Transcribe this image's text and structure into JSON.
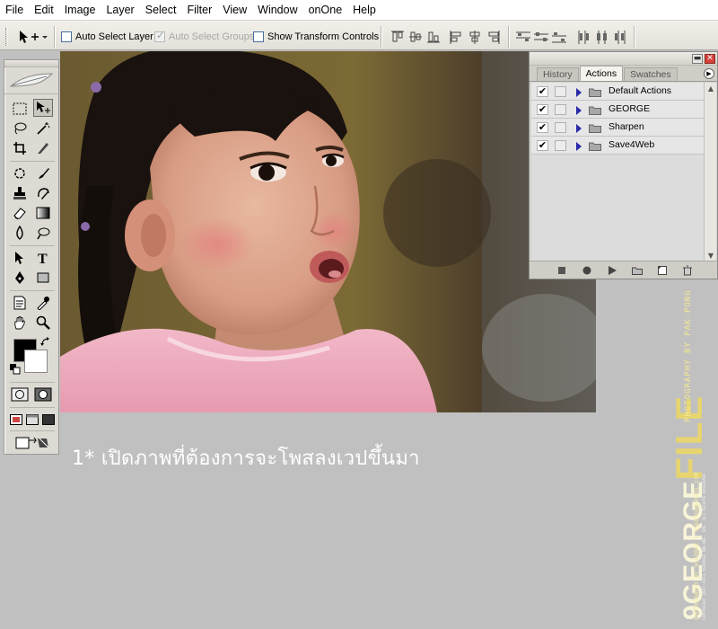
{
  "menubar": {
    "items": [
      "File",
      "Edit",
      "Image",
      "Layer",
      "Select",
      "Filter",
      "View",
      "Window",
      "onOne",
      "Help"
    ]
  },
  "options_bar": {
    "auto_select_layer": {
      "label": "Auto Select Layer",
      "checked": false
    },
    "auto_select_groups": {
      "label": "Auto Select Groups",
      "checked": true,
      "disabled": true
    },
    "show_transform_controls": {
      "label": "Show Transform Controls",
      "checked": false
    }
  },
  "toolbox": {
    "foreground_color": "#000000",
    "background_color": "#ffffff",
    "icons": [
      "rectangular-marquee-icon",
      "move-tool-icon",
      "lasso-icon",
      "magic-wand-icon",
      "crop-icon",
      "slice-icon",
      "healing-brush-icon",
      "brush-icon",
      "clone-stamp-icon",
      "history-brush-icon",
      "eraser-icon",
      "gradient-icon",
      "blur-icon",
      "dodge-icon",
      "path-selection-icon",
      "type-icon",
      "pen-icon",
      "shape-icon",
      "notes-icon",
      "eyedropper-icon",
      "hand-icon",
      "zoom-icon"
    ]
  },
  "palette": {
    "tabs": [
      {
        "label": "History",
        "active": false
      },
      {
        "label": "Actions",
        "active": true
      },
      {
        "label": "Swatches",
        "active": false
      }
    ],
    "actions": [
      {
        "label": "Default Actions",
        "checked": true
      },
      {
        "label": "GEORGE",
        "checked": true
      },
      {
        "label": "Sharpen",
        "checked": true
      },
      {
        "label": "Save4Web",
        "checked": true
      }
    ],
    "check_glyph": "✔"
  },
  "caption": {
    "text": "1* เปิดภาพที่ต้องการจะโพสลงเวปขึ้นมา"
  },
  "watermark": {
    "brand_prefix": "9GEORGE",
    "brand_suffix": "FILE",
    "photo_credit": "PHOTOGRAPHY BY PAK-PONG",
    "photo_line2": "PHOTOGRAPHY BY 9GEORGE • 9GEORGE@GMAIL.COM",
    "copyright": "COPYRIGHT 2007-2011 9GEORGE ONLINE, INC. ALL RIGHTS RESERVED."
  },
  "colors": {
    "menubar_bg": "#ffffff",
    "workspace_bg": "#c0c0c0",
    "close_button": "#d4413a",
    "watermark_gold": "#e6d470"
  }
}
